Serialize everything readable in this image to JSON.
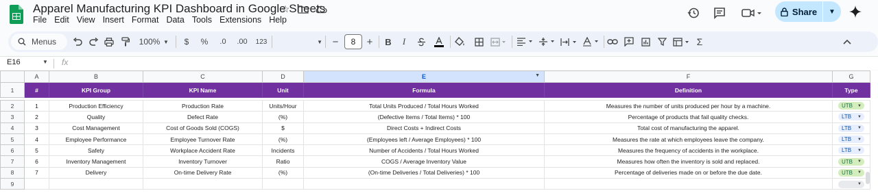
{
  "app": {
    "title": "Apparel Manufacturing KPI Dashboard in Google Sheets",
    "menu": [
      "File",
      "Edit",
      "View",
      "Insert",
      "Format",
      "Data",
      "Tools",
      "Extensions",
      "Help"
    ],
    "share_label": "Share"
  },
  "toolbar": {
    "menus_label": "Menus",
    "zoom": "100%",
    "currency": "$",
    "percent": "%",
    "dec_decrease": ".0",
    "dec_increase": ".00",
    "number_format": "123",
    "font_size": "8",
    "minus": "−",
    "plus": "+",
    "bold": "B",
    "italic": "I",
    "sum": "Σ"
  },
  "formula_bar": {
    "name_box": "E16",
    "fx": "fx"
  },
  "grid": {
    "columns": [
      "A",
      "B",
      "C",
      "D",
      "E",
      "F",
      "G"
    ],
    "selected_column": "E",
    "row_numbers": [
      "1",
      "2",
      "3",
      "4",
      "5",
      "6",
      "7",
      "8",
      "9"
    ],
    "headers": [
      "#",
      "KPI Group",
      "KPI Name",
      "Unit",
      "Formula",
      "Definition",
      "Type"
    ],
    "rows": [
      {
        "n": "1",
        "group": "Production Efficiency",
        "name": "Production Rate",
        "unit": "Units/Hour",
        "formula": "Total Units Produced / Total Hours Worked",
        "definition": "Measures the number of units produced per hour by a machine.",
        "type": "UTB"
      },
      {
        "n": "2",
        "group": "Quality",
        "name": "Defect Rate",
        "unit": "(%)",
        "formula": "(Defective Items / Total Items) * 100",
        "definition": "Percentage of products that fail quality checks.",
        "type": "LTB"
      },
      {
        "n": "3",
        "group": "Cost Management",
        "name": "Cost of Goods Sold (COGS)",
        "unit": "$",
        "formula": "Direct Costs + Indirect Costs",
        "definition": "Total cost of manufacturing the apparel.",
        "type": "LTB"
      },
      {
        "n": "4",
        "group": "Employee Performance",
        "name": "Employee Turnover Rate",
        "unit": "(%)",
        "formula": "(Employees left / Average Employees) * 100",
        "definition": "Measures the rate at which employees leave the company.",
        "type": "LTB"
      },
      {
        "n": "5",
        "group": "Safety",
        "name": "Workplace Accident Rate",
        "unit": "Incidents",
        "formula": "Number of Accidents / Total Hours Worked",
        "definition": "Measures the frequency of accidents in the workplace.",
        "type": "LTB"
      },
      {
        "n": "6",
        "group": "Inventory Management",
        "name": "Inventory Turnover",
        "unit": "Ratio",
        "formula": "COGS / Average Inventory Value",
        "definition": "Measures how often the inventory is sold and replaced.",
        "type": "UTB"
      },
      {
        "n": "7",
        "group": "Delivery",
        "name": "On-time Delivery Rate",
        "unit": "(%)",
        "formula": "(On-time Deliveries / Total Deliveries) * 100",
        "definition": "Percentage of deliveries made on or before the due date.",
        "type": "UTB"
      }
    ]
  },
  "colors": {
    "header_bg": "#7030a0",
    "utb_bg": "#d4edbc",
    "ltb_bg": "#e6eeff",
    "share_bg": "#c2e7ff"
  }
}
